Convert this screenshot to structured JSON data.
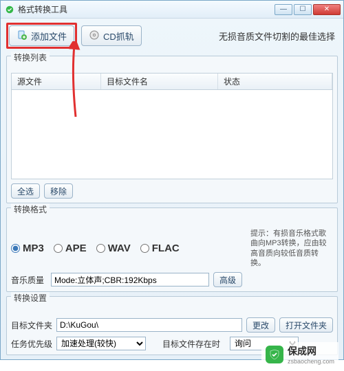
{
  "window": {
    "title": "格式转换工具"
  },
  "toolbar": {
    "add_file": "添加文件",
    "cd_grab": "CD抓轨",
    "tagline": "无损音质文件切割的最佳选择"
  },
  "list": {
    "legend": "转换列表",
    "col_source": "源文件",
    "col_target": "目标文件名",
    "col_status": "状态",
    "select_all": "全选",
    "remove": "移除"
  },
  "format": {
    "legend": "转换格式",
    "opt_mp3": "MP3",
    "opt_ape": "APE",
    "opt_wav": "WAV",
    "opt_flac": "FLAC",
    "hint_label": "提示：",
    "hint_text": "有损音乐格式歌曲向MP3转换，应由较高音质向较低音质转换。",
    "quality_label": "音乐质量",
    "quality_value": "Mode:立体声;CBR:192Kbps",
    "advanced": "高级"
  },
  "settings": {
    "legend": "转换设置",
    "dest_label": "目标文件夹",
    "dest_value": "D:\\KuGou\\",
    "change": "更改",
    "open_folder": "打开文件夹",
    "priority_label": "任务优先级",
    "priority_value": "加速处理(较快)",
    "exists_label": "目标文件存在时",
    "exists_value": "询问"
  },
  "watermark": {
    "main": "保成网",
    "sub": "zsbaocheng.com"
  }
}
